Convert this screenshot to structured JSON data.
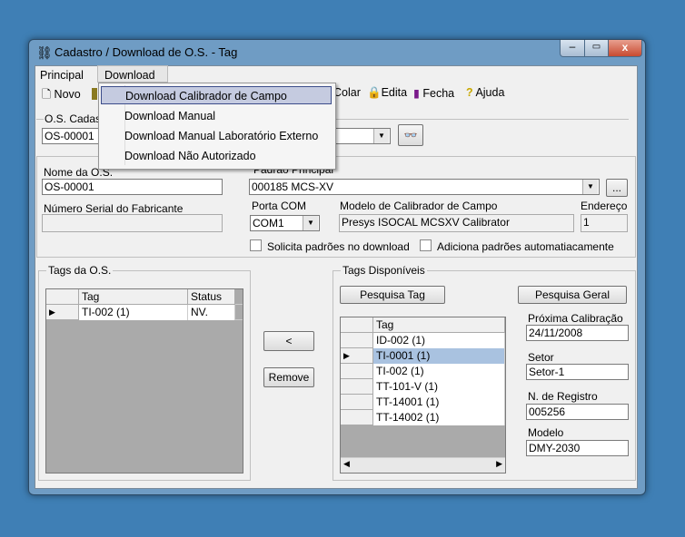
{
  "window": {
    "title": "Cadastro / Download de O.S. - Tag"
  },
  "menubar": {
    "items": [
      "Principal",
      "Download"
    ]
  },
  "download_menu": {
    "items": [
      "Download Calibrador de Campo",
      "Download Manual",
      "Download Manual Laboratório Externo",
      "Download Não Autorizado"
    ],
    "highlighted": 0
  },
  "toolbar": {
    "novo": "Novo",
    "colar": "Colar",
    "edita": "Edita",
    "fecha": "Fecha",
    "ajuda": "Ajuda"
  },
  "os_cadastro": {
    "label": "O.S. Cadastro",
    "value": "OS-00001"
  },
  "form": {
    "nome_label": "Nome da O.S.",
    "nome_value": "OS-00001",
    "padrao_label": "Padrão Principal",
    "padrao_value": "000185 MCS-XV",
    "padrao_button": "...",
    "serial_label": "Número Serial do Fabricante",
    "serial_value": "",
    "porta_label": "Porta COM",
    "porta_value": "COM1",
    "modelo_label": "Modelo de Calibrador de Campo",
    "modelo_value": "Presys ISOCAL MCSXV Calibrator",
    "endereco_label": "Endereço",
    "endereco_value": "1",
    "chk1": "Solicita padrões no download",
    "chk2": "Adiciona padrões automatiacamente"
  },
  "tags_os": {
    "title": "Tags da O.S.",
    "columns": [
      "Tag",
      "Status"
    ],
    "rows": [
      {
        "tag": "TI-002 (1)",
        "status": "NV."
      }
    ]
  },
  "middle": {
    "move_left": "<",
    "remove": "Remove"
  },
  "tags_disp": {
    "title": "Tags Disponíveis",
    "pesquisa_tag": "Pesquisa Tag",
    "pesquisa_geral": "Pesquisa Geral",
    "column": "Tag",
    "rows": [
      "ID-002 (1)",
      "TI-0001 (1)",
      "TI-002 (1)",
      "TT-101-V (1)",
      "TT-14001 (1)",
      "TT-14002 (1)"
    ],
    "selected": 1
  },
  "details": {
    "prox_label": "Próxima Calibração",
    "prox_value": "24/11/2008",
    "setor_label": "Setor",
    "setor_value": "Setor-1",
    "registro_label": "N. de Registro",
    "registro_value": "005256",
    "modelo_label": "Modelo",
    "modelo_value": "DMY-2030"
  }
}
